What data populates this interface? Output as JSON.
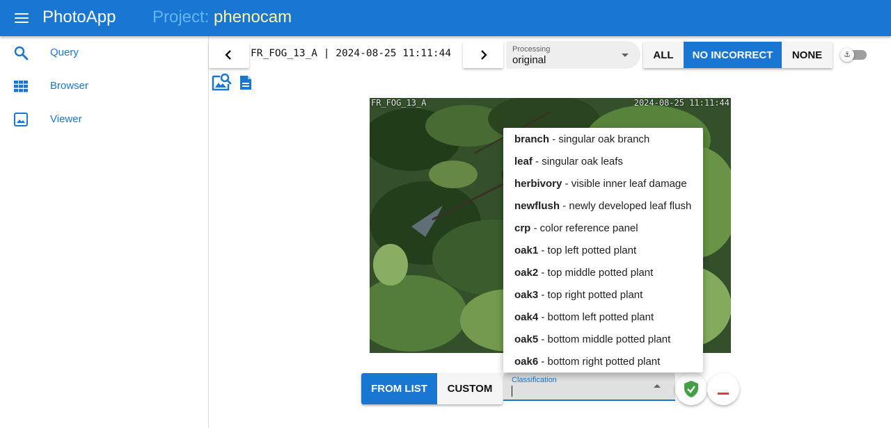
{
  "app": {
    "title": "PhotoApp",
    "project_prefix": "Project:",
    "project_name": "phenocam"
  },
  "sidebar": {
    "items": [
      {
        "label": "Query",
        "icon": "search-icon"
      },
      {
        "label": "Browser",
        "icon": "grid-icon"
      },
      {
        "label": "Viewer",
        "icon": "image-icon"
      }
    ]
  },
  "toolbar": {
    "image_id": "FR_FOG_13_A | 2024-08-25 11:11:44",
    "processing_label": "Processing",
    "processing_value": "original",
    "filter_buttons": {
      "all": "ALL",
      "no_incorrect": "NO INCORRECT",
      "none": "NONE"
    },
    "anchor_icon": "⚓"
  },
  "photo": {
    "overlay_left": "FR_FOG_13_A",
    "overlay_right": "2024-08-25 11:11:44"
  },
  "classification_menu": {
    "items": [
      {
        "key": "branch",
        "desc": " - singular oak branch"
      },
      {
        "key": "leaf",
        "desc": " - singular oak leafs"
      },
      {
        "key": "herbivory",
        "desc": " - visible inner leaf damage"
      },
      {
        "key": "newflush",
        "desc": " - newly developed leaf flush"
      },
      {
        "key": "crp",
        "desc": " - color reference panel"
      },
      {
        "key": "oak1",
        "desc": " - top left potted plant"
      },
      {
        "key": "oak2",
        "desc": " - top middle potted plant"
      },
      {
        "key": "oak3",
        "desc": " - top right potted plant"
      },
      {
        "key": "oak4",
        "desc": " - bottom left potted plant"
      },
      {
        "key": "oak5",
        "desc": " - bottom middle potted plant"
      },
      {
        "key": "oak6",
        "desc": " - bottom right potted plant"
      }
    ]
  },
  "bottom": {
    "from_list": "FROM LIST",
    "custom": "CUSTOM",
    "classification_label": "Classification",
    "classification_value": ""
  },
  "colors": {
    "primary": "#1976d2",
    "project_name": "#fff59d",
    "confirm": "#43a047",
    "remove": "#e53935"
  }
}
